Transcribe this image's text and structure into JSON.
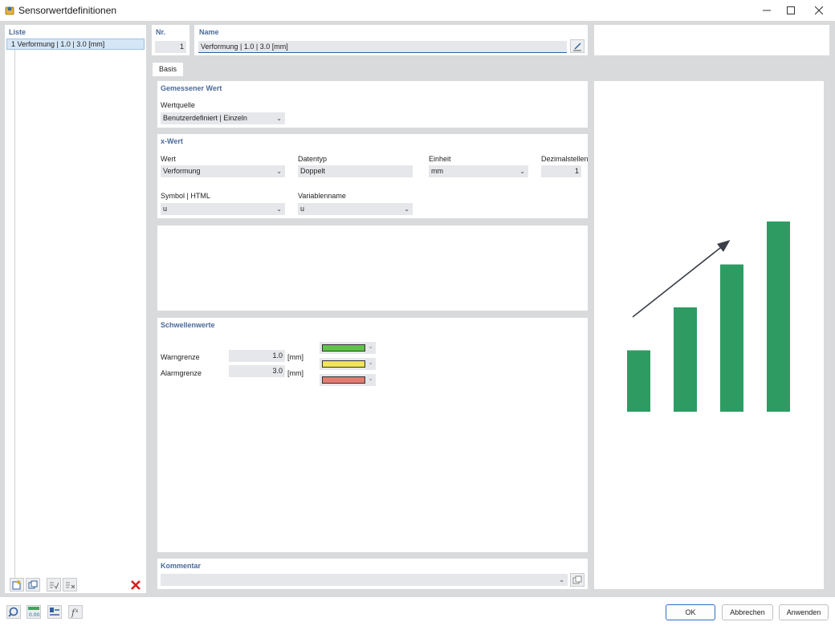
{
  "window": {
    "title": "Sensorwertdefinitionen",
    "maximize_icon": "square-icon",
    "close_icon": "x-icon"
  },
  "list": {
    "header": "Liste",
    "items": [
      {
        "label": "1  Verformung | 1.0 | 3.0 [mm]"
      }
    ]
  },
  "header": {
    "nr_label": "Nr.",
    "nr_value": "1",
    "name_label": "Name",
    "name_value": "Verformung | 1.0 | 3.0 [mm]"
  },
  "tabs": [
    {
      "label": "Basis"
    }
  ],
  "measured": {
    "title": "Gemessener Wert",
    "source_label": "Wertquelle",
    "source_value": "Benutzerdefiniert | Einzeln"
  },
  "xvalue": {
    "title": "x-Wert",
    "wert_label": "Wert",
    "wert_value": "Verformung",
    "datentyp_label": "Datentyp",
    "datentyp_value": "Doppelt",
    "einheit_label": "Einheit",
    "einheit_value": "mm",
    "dezimal_label": "Dezimalstellen",
    "dezimal_value": "1",
    "symbol_label": "Symbol | HTML",
    "symbol_value": "u",
    "variable_label": "Variablenname",
    "variable_value": "u"
  },
  "thresholds": {
    "title": "Schwellenwerte",
    "warn_label": "Warngrenze",
    "warn_value": "1.0",
    "warn_unit": "[mm]",
    "alarm_label": "Alarmgrenze",
    "alarm_value": "3.0",
    "alarm_unit": "[mm]",
    "colors": [
      "#5fc34a",
      "#f0e45a",
      "#e27d72"
    ]
  },
  "comment": {
    "title": "Kommentar",
    "value": ""
  },
  "illustration": {
    "bar_color": "#2e9b63",
    "arrow_color": "#3a3f4a",
    "bars": [
      1,
      2,
      3,
      4
    ]
  },
  "buttons": {
    "ok": "OK",
    "cancel": "Abbrechen",
    "apply": "Anwenden"
  }
}
